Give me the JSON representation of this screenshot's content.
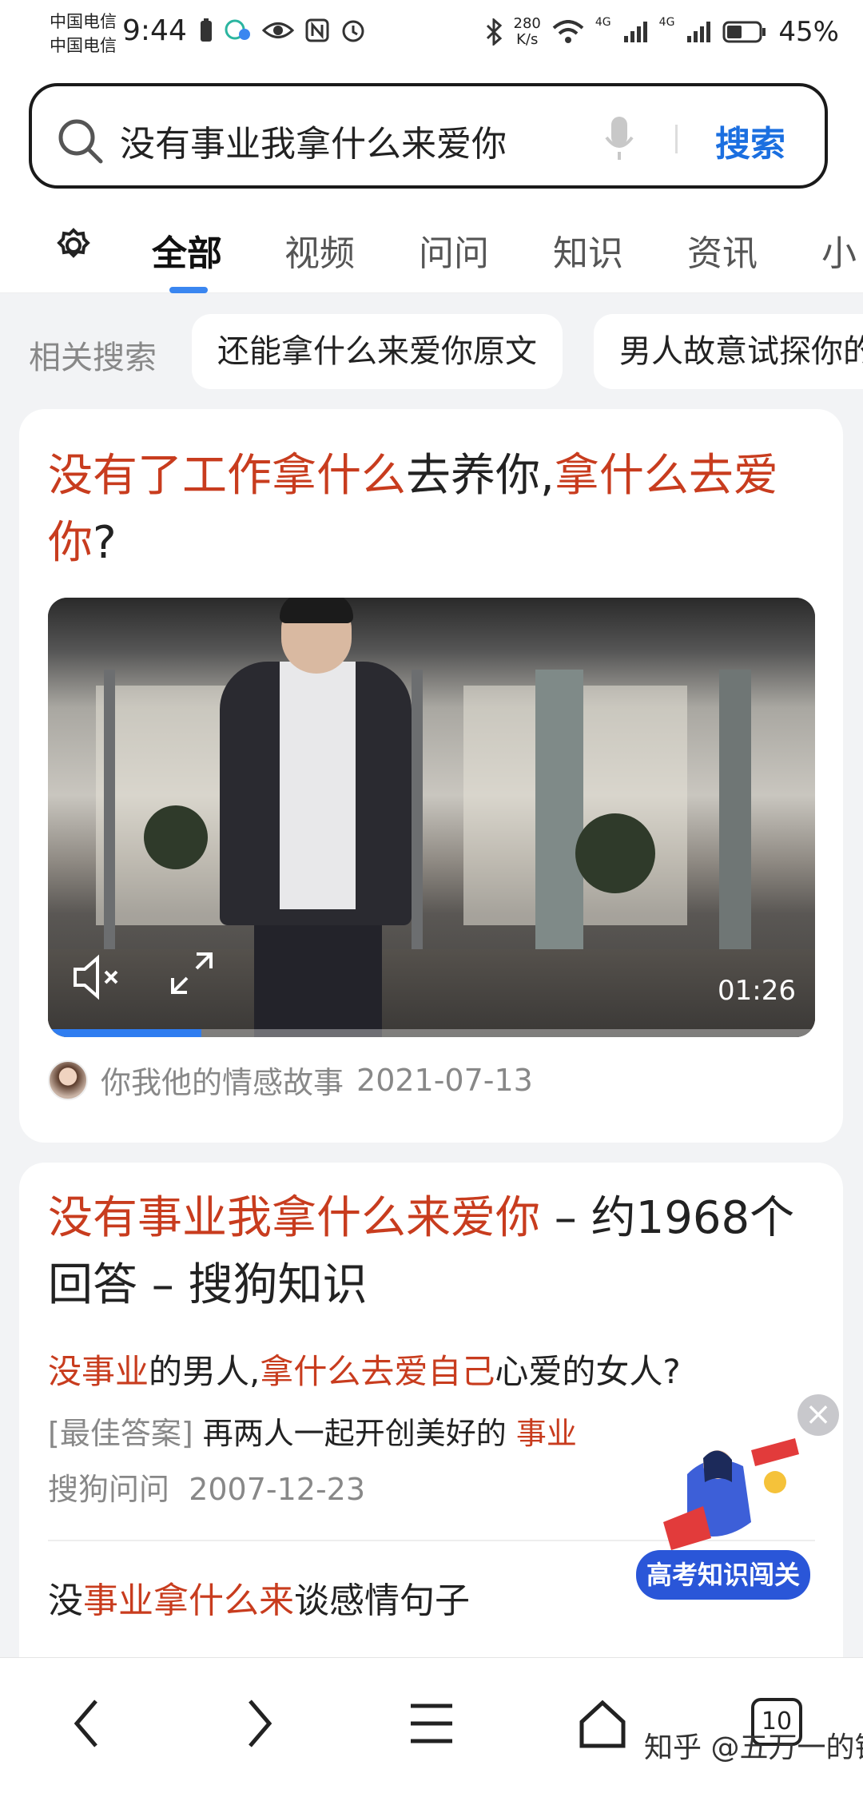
{
  "status": {
    "carrier1": "中国电信",
    "carrier2": "中国电信",
    "time": "9:44",
    "speed_top": "280",
    "speed_bottom": "K/s",
    "net1": "4G",
    "net2": "4G",
    "battery": "45%"
  },
  "search": {
    "query": "没有事业我拿什么来爱你",
    "submit_label": "搜索"
  },
  "tabs": [
    "全部",
    "视频",
    "问问",
    "知识",
    "资讯",
    "小"
  ],
  "active_tab": 0,
  "related": {
    "label": "相关搜索",
    "chips": [
      "还能拿什么来爱你原文",
      "男人故意试探你的"
    ]
  },
  "result1": {
    "title_parts": [
      {
        "text": "没有了工作拿什么",
        "hl": true
      },
      {
        "text": "去养你,",
        "hl": false
      },
      {
        "text": "拿什么去爱你",
        "hl": true
      },
      {
        "text": "?",
        "hl": false
      }
    ],
    "video": {
      "duration": "01:26",
      "progress": 0.2
    },
    "source": "你我他的情感故事",
    "date": "2021-07-13"
  },
  "result2": {
    "title_parts": [
      {
        "text": "没有事业我拿什么来爱你",
        "hl": true
      },
      {
        "text": " – 约1968个回答 – 搜狗知识",
        "hl": false
      }
    ],
    "question_parts": [
      {
        "text": "没事业",
        "hl": true
      },
      {
        "text": "的男人,",
        "hl": false
      },
      {
        "text": "拿什么去爱自己",
        "hl": true
      },
      {
        "text": "心爱的女人?",
        "hl": false
      }
    ],
    "answer_prefix": "[最佳答案]",
    "answer_text": " 再两人一起开创美好的 ",
    "answer_hl": "事业",
    "source": "搜狗问问",
    "date": "2007-12-23",
    "sub_parts": [
      {
        "text": "没",
        "hl": false
      },
      {
        "text": "事业拿什么来",
        "hl": true
      },
      {
        "text": "谈感情句子",
        "hl": false
      }
    ]
  },
  "promo": {
    "button_label": "高考知识闯关",
    "close": "×"
  },
  "bottom_nav": {
    "tab_count": "10"
  },
  "watermark": "知乎 @五万一的错",
  "colors": {
    "highlight": "#c83c1e",
    "accent": "#1b6fe0",
    "background": "#f2f3f5"
  }
}
